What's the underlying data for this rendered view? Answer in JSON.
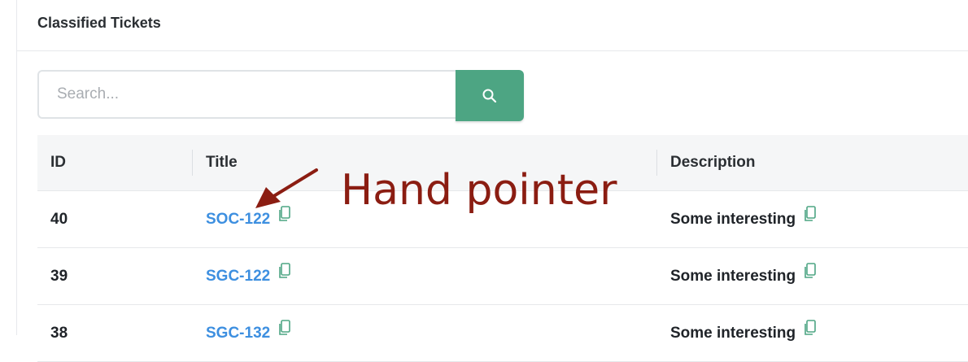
{
  "panel": {
    "title": "Classified Tickets"
  },
  "search": {
    "placeholder": "Search...",
    "value": "",
    "button_icon": "search-icon"
  },
  "table": {
    "columns": [
      {
        "label": "ID"
      },
      {
        "label": "Title"
      },
      {
        "label": "Description"
      }
    ],
    "rows": [
      {
        "id": "40",
        "title": "SOC-122",
        "description": "Some interesting"
      },
      {
        "id": "39",
        "title": "SGC-122",
        "description": "Some interesting"
      },
      {
        "id": "38",
        "title": "SGC-132",
        "description": "Some interesting"
      }
    ]
  },
  "annotation": {
    "text": "Hand pointer",
    "icon": "arrow-icon"
  },
  "colors": {
    "accent": "#4da583",
    "link": "#3d8fe0",
    "annotation": "#8b1d12",
    "copy_icon": "#4da583"
  }
}
